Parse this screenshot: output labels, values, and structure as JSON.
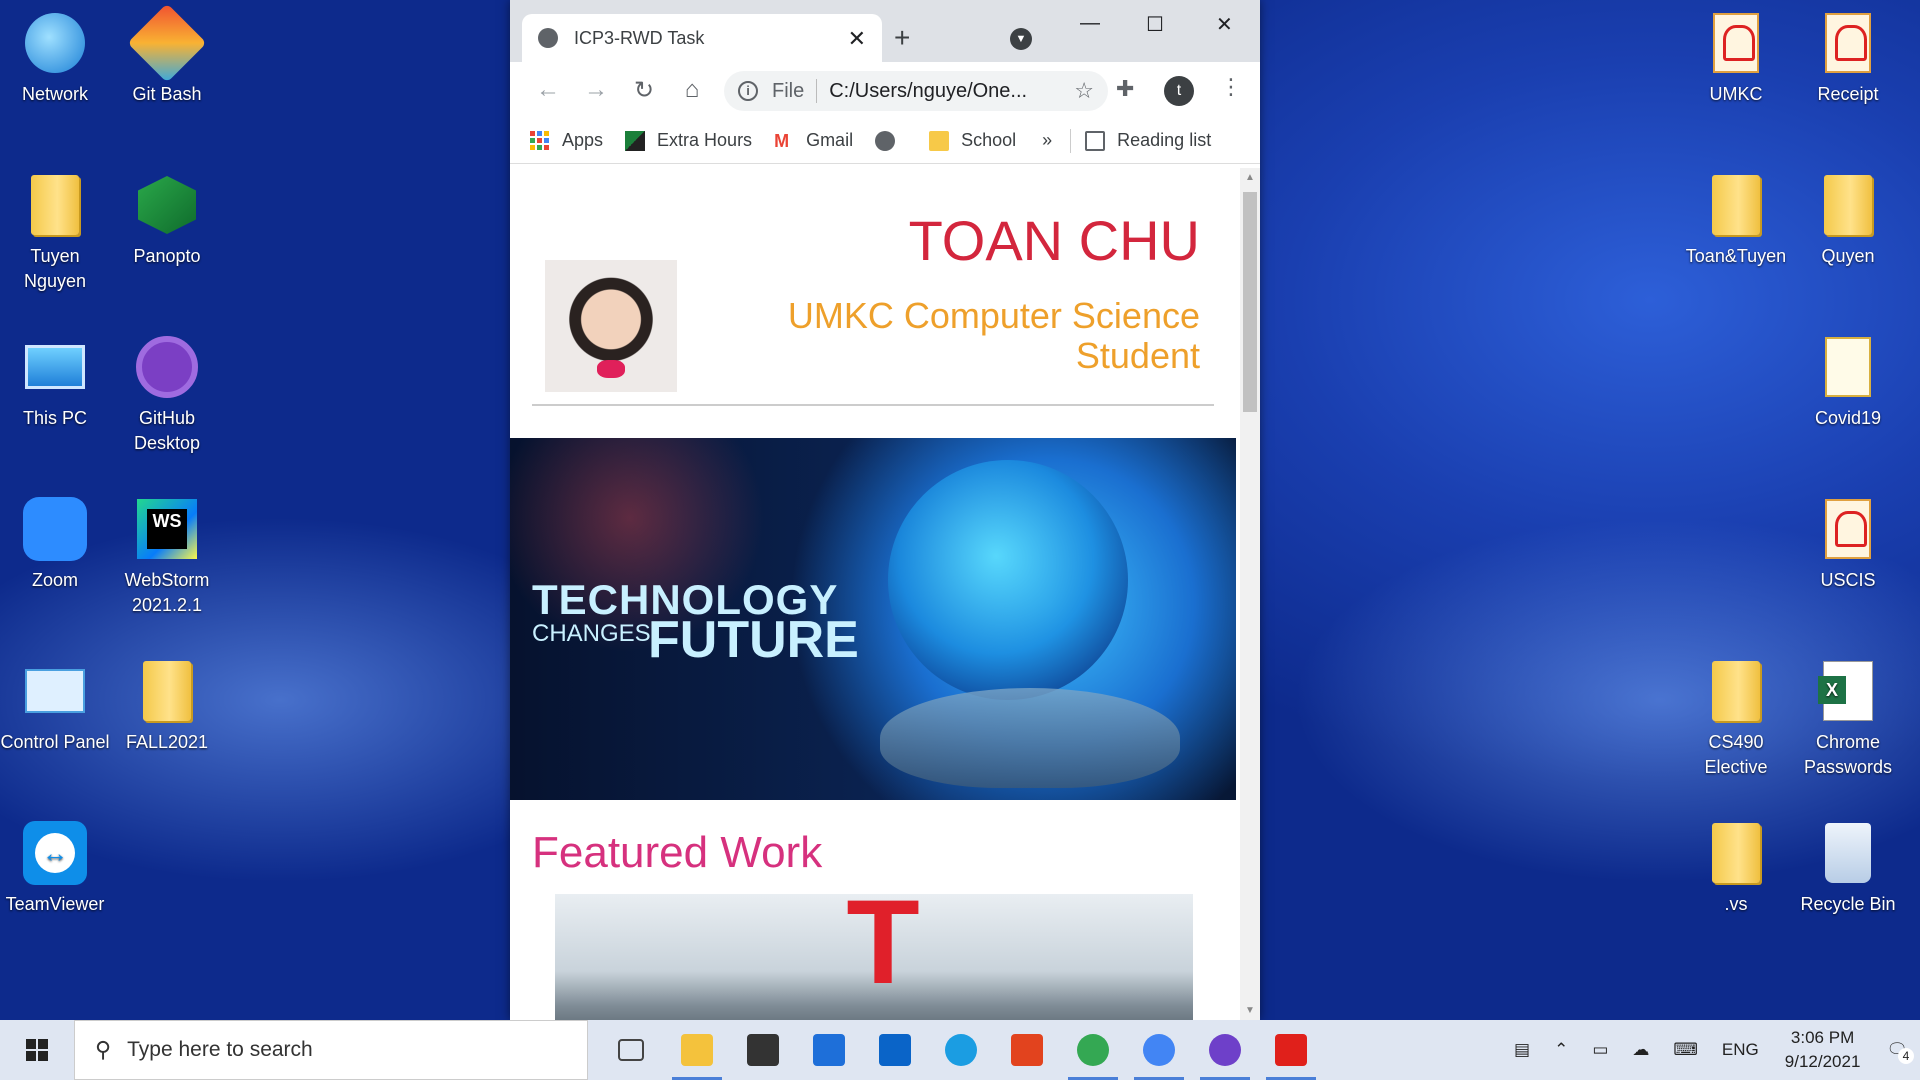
{
  "desktop": {
    "left_icons": [
      {
        "label": "Network",
        "icon": "network-icon",
        "col": 0,
        "row": 0
      },
      {
        "label": "Git Bash",
        "icon": "git-bash-icon",
        "col": 1,
        "row": 0
      },
      {
        "label": "Tuyen Nguyen",
        "icon": "user-folder-icon",
        "col": 0,
        "row": 1
      },
      {
        "label": "Panopto",
        "icon": "panopto-icon",
        "col": 1,
        "row": 1
      },
      {
        "label": "This PC",
        "icon": "computer-icon",
        "col": 0,
        "row": 2
      },
      {
        "label": "GitHub Desktop",
        "icon": "github-icon",
        "col": 1,
        "row": 2
      },
      {
        "label": "Zoom",
        "icon": "zoom-icon",
        "col": 0,
        "row": 3
      },
      {
        "label": "WebStorm 2021.2.1",
        "icon": "webstorm-icon",
        "col": 1,
        "row": 3
      },
      {
        "label": "Control Panel",
        "icon": "control-panel-icon",
        "col": 0,
        "row": 4
      },
      {
        "label": "FALL2021",
        "icon": "folder-icon",
        "col": 1,
        "row": 4
      },
      {
        "label": "TeamViewer",
        "icon": "teamviewer-icon",
        "col": 0,
        "row": 5
      }
    ],
    "right_icons": [
      {
        "label": "UMKC",
        "icon": "pdf-icon"
      },
      {
        "label": "Receipt",
        "icon": "pdf-icon"
      },
      {
        "label": "Toan&Tuyen",
        "icon": "folder-icon"
      },
      {
        "label": "Quyen",
        "icon": "folder-icon"
      },
      {
        "label": "Covid19",
        "icon": "file-icon"
      },
      {
        "label": "USCIS",
        "icon": "pdf-icon"
      },
      {
        "label": "CS490 Elective",
        "icon": "folder-icon"
      },
      {
        "label": "Chrome Passwords",
        "icon": "excel-icon"
      },
      {
        "label": ".vs",
        "icon": "folder-icon"
      },
      {
        "label": "Recycle Bin",
        "icon": "recycle-bin-icon"
      }
    ]
  },
  "browser": {
    "tab_title": "ICP3-RWD Task",
    "omnibox_scheme": "File",
    "omnibox_url": "C:/Users/nguye/One...",
    "profile_initial": "t",
    "bookmarks": [
      "Apps",
      "Extra Hours",
      "Gmail",
      "",
      "School"
    ],
    "overflow": "»",
    "reading_list": "Reading list"
  },
  "page": {
    "name": "TOAN CHU",
    "subtitle": "UMKC Computer Science Student",
    "banner_line1": "TECHNOLOGY",
    "banner_line2": "CHANGES",
    "banner_line3": "FUTURE",
    "featured_heading": "Featured Work"
  },
  "taskbar": {
    "search_placeholder": "Type here to search",
    "language": "ENG",
    "time": "3:06 PM",
    "date": "9/12/2021",
    "notifications": "4",
    "apps": [
      {
        "name": "task-view-icon",
        "color": "#444444"
      },
      {
        "name": "file-explorer-icon",
        "color": "#f4c23c"
      },
      {
        "name": "microsoft-store-icon",
        "color": "#333333"
      },
      {
        "name": "mail-icon",
        "color": "#1e6fd9"
      },
      {
        "name": "outlook-icon",
        "color": "#0a64c8"
      },
      {
        "name": "edge-icon",
        "color": "#1b9de2"
      },
      {
        "name": "office-icon",
        "color": "#e2431e"
      },
      {
        "name": "chrome-icon",
        "color": "#34a853"
      },
      {
        "name": "chrome-profile-icon",
        "color": "#4285f4"
      },
      {
        "name": "github-desktop-icon",
        "color": "#6e40c9"
      },
      {
        "name": "acrobat-icon",
        "color": "#e0201b"
      }
    ]
  }
}
